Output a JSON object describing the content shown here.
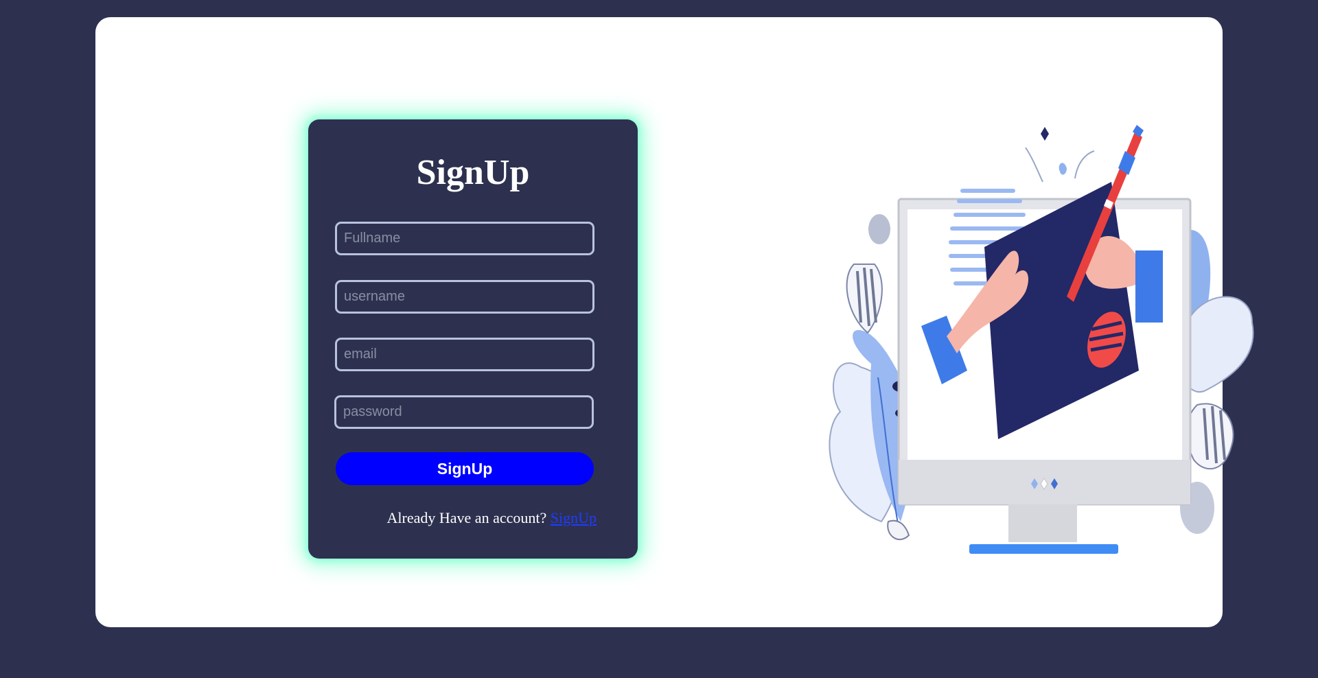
{
  "form": {
    "title": "SignUp",
    "fields": {
      "fullname_placeholder": "Fullname",
      "username_placeholder": "username",
      "email_placeholder": "email",
      "password_placeholder": "password"
    },
    "submit_label": "SignUp",
    "account_prompt": "Already Have an account?",
    "account_link": "SignUp"
  },
  "colors": {
    "background": "#2d314f",
    "card": "#ffffff",
    "panel_glow": "#6effc8",
    "button": "#0000ff",
    "link": "#1f3cff"
  },
  "illustration": {
    "icon": "computer-drawing-illustration"
  }
}
